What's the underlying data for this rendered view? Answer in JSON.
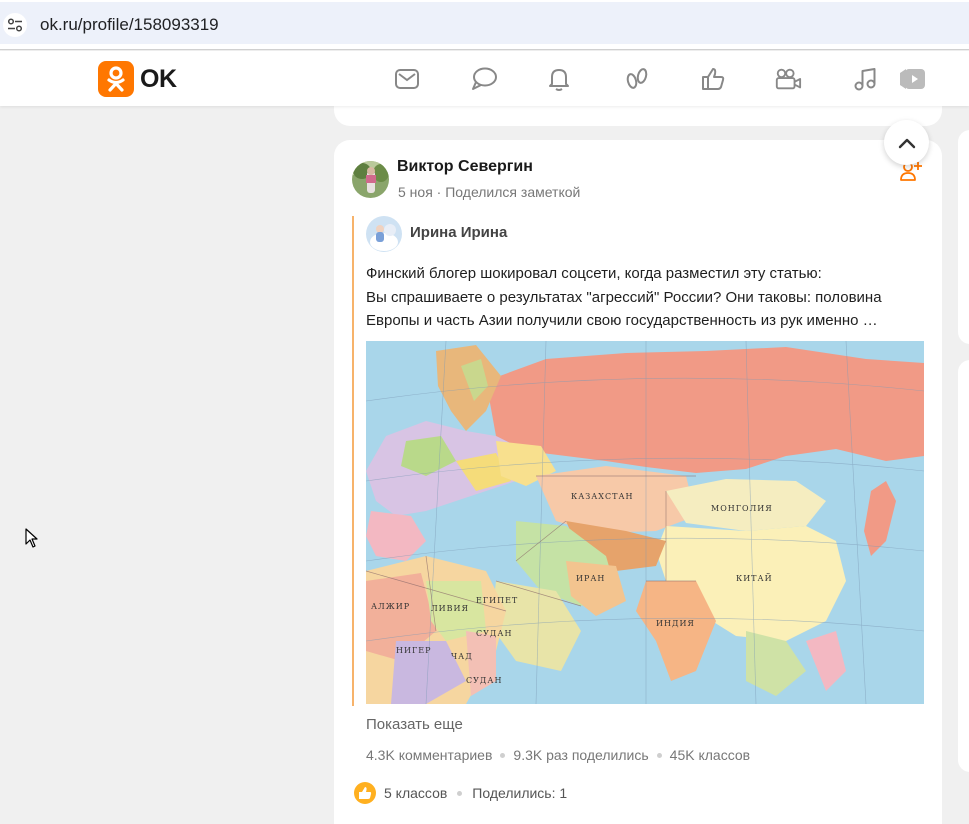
{
  "browser": {
    "url": "ok.ru/profile/158093319",
    "site_info_icon": "tune-icon"
  },
  "header": {
    "logo_text": "OK",
    "logo_color": "#ff7700",
    "nav_icons": [
      "messages-icon",
      "discussions-icon",
      "notifications-icon",
      "guests-icon",
      "events-icon",
      "video-icon",
      "music-icon",
      "video-showcase-icon"
    ]
  },
  "post": {
    "author_name": "Виктор Севергин",
    "date": "5 ноя",
    "action": "Поделился заметкой",
    "shared": {
      "author_name": "Ирина Ирина",
      "text_lines": [
        "Финский блогер шокировал соцсети, когда разместил эту статью:",
        "Вы спрашиваете о результатах \"агрессий\" России? Они таковы: половина",
        "Европы и часть Азии получили свою государственность из рук именно …"
      ],
      "map_labels": [
        "КАЗАХСТАН",
        "МОНГОЛИЯ",
        "ИРАН",
        "ЛИВИЯ",
        "АЛЖИР",
        "ЕГИПЕТ",
        "СУДАН",
        "НИГЕР",
        "ЧАД",
        "СУДАН",
        "КИТАЙ",
        "ИНДИЯ"
      ],
      "show_more": "Показать еще",
      "stats": {
        "comments": "4.3K комментариев",
        "shares": "9.3K раз поделились",
        "likes": "45K классов"
      }
    },
    "footer": {
      "likes": "5 классов",
      "shares": "Поделились: 1"
    }
  }
}
